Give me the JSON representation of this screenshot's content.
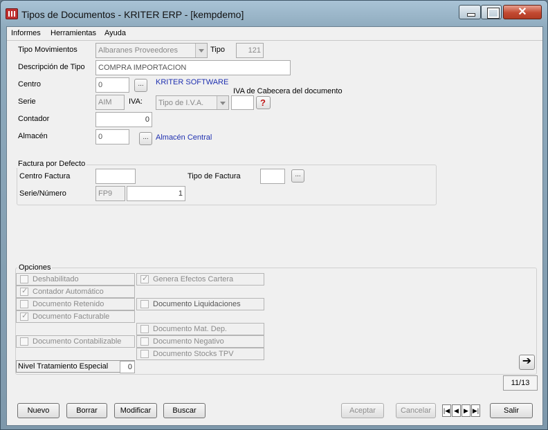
{
  "window": {
    "title": "Tipos de Documentos - KRITER ERP - [kempdemo]"
  },
  "menu": [
    "Informes",
    "Herramientas",
    "Ayuda"
  ],
  "form": {
    "tipo_mov_label": "Tipo Movimientos",
    "tipo_mov_value": "Albaranes Proveedores",
    "tipo_label": "Tipo",
    "tipo_value": "121",
    "descripcion_label": "Descripción de Tipo",
    "descripcion_value": "COMPRA IMPORTACION",
    "centro_label": "Centro",
    "centro_value": "0",
    "centro_ellipsis": "...",
    "centro_name": "KRITER SOFTWARE",
    "iva_cabecera_label": "IVA de Cabecera del documento",
    "serie_label": "Serie",
    "serie_value": "AIM",
    "iva_label": "IVA:",
    "iva_value": "Tipo de I.V.A.",
    "contador_label": "Contador",
    "contador_value": "0",
    "almacen_label": "Almacén",
    "almacen_value": "0",
    "almacen_ellipsis": "...",
    "almacen_name": "Almacén Central"
  },
  "factura": {
    "group_title": "Factura por Defecto",
    "centro_label": "Centro Factura",
    "centro_value": "",
    "tipo_label": "Tipo de Factura",
    "tipo_value": "",
    "tipo_ellipsis": "...",
    "serie_label": "Serie/Número",
    "serie_value": "FP9",
    "numero_value": "1"
  },
  "opciones": {
    "group_title": "Opciones",
    "left": [
      {
        "label": "Deshabilitado",
        "checked": false
      },
      {
        "label": "Contador Automático",
        "checked": true
      },
      {
        "label": "Documento Retenido",
        "checked": false
      },
      {
        "label": "Documento Facturable",
        "checked": true
      },
      {
        "label": "Documento Contabilizable",
        "checked": false
      }
    ],
    "right": [
      {
        "label": "Genera Efectos Cartera",
        "checked": true
      },
      {
        "label": "Documento Liquidaciones",
        "checked": false
      },
      {
        "label": "Documento Mat. Dep.",
        "checked": false
      },
      {
        "label": "Documento Negativo",
        "checked": false
      },
      {
        "label": "Documento Stocks TPV",
        "checked": false
      }
    ],
    "nivel_label": "Nivel Tratamiento Especial",
    "nivel_value": "0"
  },
  "record_counter": "11/13",
  "buttons": {
    "nuevo": "Nuevo",
    "borrar": "Borrar",
    "modificar": "Modificar",
    "buscar": "Buscar",
    "aceptar": "Aceptar",
    "cancelar": "Cancelar",
    "salir": "Salir"
  },
  "nav": {
    "first": "|◀",
    "prev": "◀",
    "next": "▶",
    "last": "▶|"
  }
}
